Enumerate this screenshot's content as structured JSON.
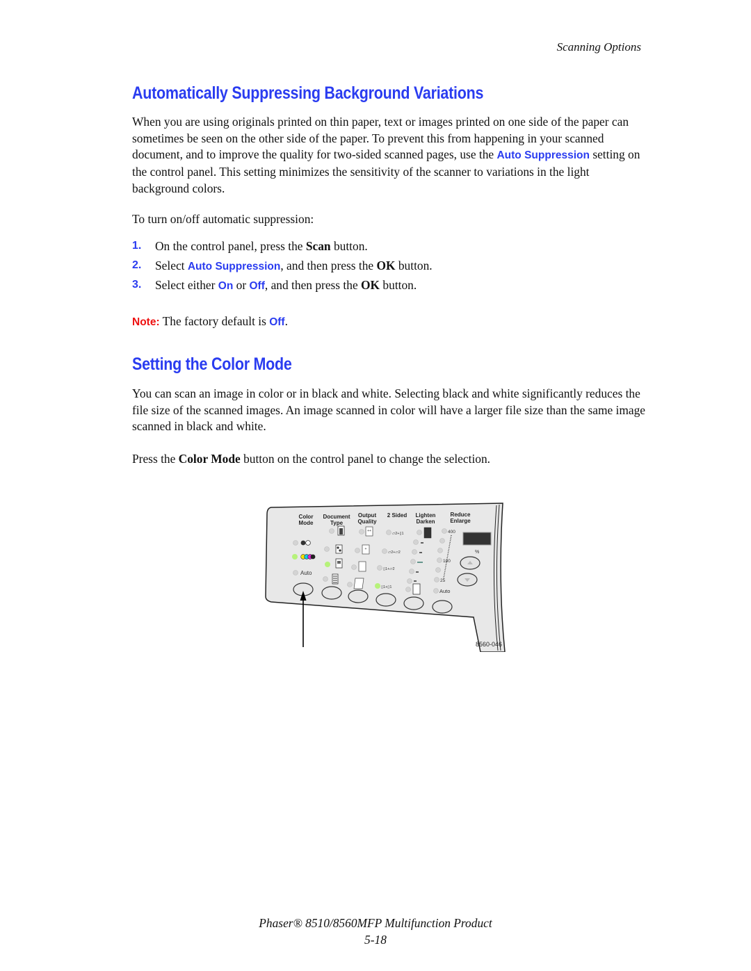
{
  "header": {
    "running_title": "Scanning Options"
  },
  "section1": {
    "heading": "Automatically Suppressing Background Variations",
    "intro_part1": "When you are using originals printed on thin paper, text or images printed on one side of the paper can sometimes be seen on the other side of the paper. To prevent this from happening in your scanned document, and to improve the quality for two-sided scanned pages, use the ",
    "intro_highlight": "Auto Suppression",
    "intro_part2": " setting on the control panel. This setting minimizes the sensitivity of the scanner to variations in the light background colors.",
    "lead_in": "To turn on/off automatic suppression:",
    "steps": [
      {
        "num": "1.",
        "a": "On the control panel, press the ",
        "b": "Scan",
        "c": " button."
      },
      {
        "num": "2.",
        "a": "Select ",
        "hl": "Auto Suppression",
        "b1": ", and then press the ",
        "b": "OK",
        "c": " button."
      },
      {
        "num": "3.",
        "a": "Select either ",
        "hl1": "On",
        "mid": " or ",
        "hl2": "Off",
        "b1": ", and then press the ",
        "b": "OK",
        "c": " button."
      }
    ],
    "note_label": "Note:",
    "note_text": " The factory default is ",
    "note_value": "Off",
    "note_end": "."
  },
  "section2": {
    "heading": "Setting the Color Mode",
    "body": "You can scan an image in color or in black and white. Selecting black and white significantly reduces the file size of the scanned images. An image scanned in color will have a larger file size than the same image scanned in black and white.",
    "instr_a": "Press the ",
    "instr_b": "Color Mode",
    "instr_c": " button on the control panel to change the selection."
  },
  "figure": {
    "columns": [
      {
        "line1": "Color",
        "line2": "Mode"
      },
      {
        "line1": "Document",
        "line2": "Type"
      },
      {
        "line1": "Output",
        "line2": "Quality"
      },
      {
        "line1": "2 Sided",
        "line2": ""
      },
      {
        "line1": "Lighten",
        "line2": "Darken"
      },
      {
        "line1": "Reduce",
        "line2": "Enlarge"
      }
    ],
    "auto_label": "Auto",
    "scale_labels": [
      "400",
      "100",
      "25"
    ],
    "percent_label": "%",
    "figure_id": "8560-046",
    "colors": {
      "panel": "#e8e8e8",
      "led_active": "#b6f27a",
      "heading": "#2a3cf0",
      "note": "#ee1111"
    }
  },
  "footer": {
    "product": "Phaser® 8510/8560MFP Multifunction Product",
    "page": "5-18"
  }
}
